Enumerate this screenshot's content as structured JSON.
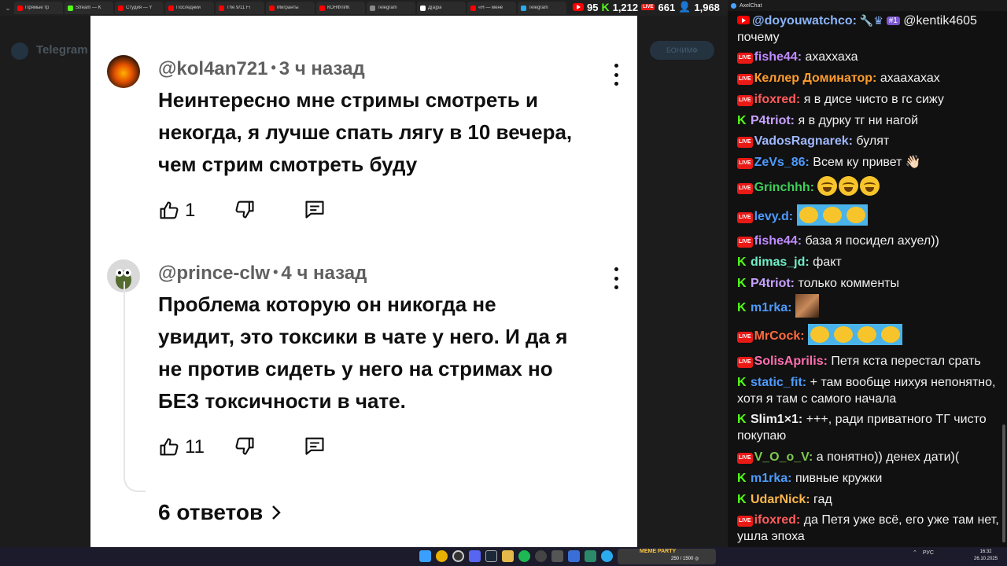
{
  "browser": {
    "tabs": [
      {
        "title": "Прямые тр",
        "color": "#ff0000"
      },
      {
        "title": "Stream — K",
        "color": "#53fc18"
      },
      {
        "title": "Студия — Y",
        "color": "#ff0000"
      },
      {
        "title": "Последний",
        "color": "#ff0000"
      },
      {
        "title": "The 9/11 Fi",
        "color": "#ff0000"
      },
      {
        "title": "Мигранты",
        "color": "#ff0000"
      },
      {
        "title": "КОНФЛИК",
        "color": "#ff0000"
      },
      {
        "title": "Telegram",
        "color": "#888888"
      },
      {
        "title": "Д[а]ра",
        "color": "#ffffff"
      },
      {
        "title": "«Я — мене",
        "color": "#ff0000"
      },
      {
        "title": "Telegram",
        "color": "#2aabee"
      }
    ]
  },
  "stats": {
    "youtube": "95",
    "kick": "1,212",
    "live": "661",
    "users": "1,968"
  },
  "background": {
    "app_title": "Telegram",
    "button": "БОНИМФ"
  },
  "comments": [
    {
      "author": "@kol4an721",
      "time": "3 ч назад",
      "text_lines": [
        "Неинтересно мне стримы смотреть и",
        "некогда, я лучше спать лягу в 10 вечера,",
        "чем стрим смотреть буду"
      ],
      "likes": "1"
    },
    {
      "author": "@prince-clw",
      "time": "4 ч назад",
      "text_lines": [
        "Проблема которую он никогда не",
        "увидит, это токсики в чате у него. И да я",
        "не против сидеть у него на стримах но",
        "БЕЗ токсичности в чате."
      ],
      "likes": "11",
      "replies": "6 ответов"
    }
  ],
  "chat": {
    "app": "AxelChat",
    "messages": [
      {
        "platform": "youtube",
        "nick": "@doyouwatchco:",
        "color": "#8ab4f8",
        "badge": "#1",
        "text": "@kentik4605 почему",
        "type": "badges"
      },
      {
        "platform": "live",
        "nick": "fishe44:",
        "color": "#c08bff",
        "text": "ахаххаха"
      },
      {
        "platform": "live",
        "nick": "Келлер Доминатор:",
        "color": "#ff9d2e",
        "text": "ахаахахах"
      },
      {
        "platform": "live",
        "nick": "ifoxred:",
        "color": "#ff5c5c",
        "text": "я в дисе чисто в гс сижу"
      },
      {
        "platform": "kick",
        "nick": "P4triot:",
        "color": "#c8a2ff",
        "text": "я в дурку тг ни нагой"
      },
      {
        "platform": "live",
        "nick": "VadosRagnarek:",
        "color": "#9fb8ff",
        "text": "булят"
      },
      {
        "platform": "live",
        "nick": "ZeVs_86:",
        "color": "#4d9bff",
        "text": "Всем ку привет 👋🏻"
      },
      {
        "platform": "live",
        "nick": "Grinchhh:",
        "color": "#3fcf5a",
        "text": "",
        "emotes": 3,
        "emote_type": "round"
      },
      {
        "platform": "live",
        "nick": "levy.d:",
        "color": "#4d9bff",
        "text": "",
        "emotes": 3,
        "emote_type": "wide"
      },
      {
        "platform": "live",
        "nick": "fishe44:",
        "color": "#c08bff",
        "text": "база я посидел ахуел))"
      },
      {
        "platform": "kick",
        "nick": "dimas_jd:",
        "color": "#6ff0c8",
        "text": "факт"
      },
      {
        "platform": "kick",
        "nick": "P4triot:",
        "color": "#c8a2ff",
        "text": "только комменты"
      },
      {
        "platform": "kick",
        "nick": "m1rka:",
        "color": "#4d9bff",
        "text": "",
        "emotes": 1,
        "emote_type": "photo"
      },
      {
        "platform": "live",
        "nick": "MrCock:",
        "color": "#ff6a3d",
        "text": "",
        "emotes": 4,
        "emote_type": "wide"
      },
      {
        "platform": "live",
        "nick": "SolisAprilis:",
        "color": "#ff6fb0",
        "text": "Петя кста перестал срать"
      },
      {
        "platform": "kick",
        "nick": "static_fit:",
        "color": "#4d9bff",
        "text": "+ там вообще нихуя непонятно, хотя я там с самого начала"
      },
      {
        "platform": "kick",
        "nick": "Slim1×1:",
        "color": "#f0f0f0",
        "text": "+++, ради приватного ТГ чисто покупаю"
      },
      {
        "platform": "live",
        "nick": "V_O_o_V:",
        "color": "#7ec850",
        "text": "а понятно)) денех дати)("
      },
      {
        "platform": "kick",
        "nick": "m1rka:",
        "color": "#4d9bff",
        "text": "пивные кружки"
      },
      {
        "platform": "kick",
        "nick": "UdarNick:",
        "color": "#ffb84d",
        "text": "гад"
      },
      {
        "platform": "live",
        "nick": "ifoxred:",
        "color": "#ff5c5c",
        "text": "да Петя уже всё, его уже там нет, ушла эпоха"
      }
    ]
  },
  "taskbar": {
    "widget_label": "MEME PARTY",
    "widget_value": "250 / 1500 ◎",
    "lang": "РУС",
    "time": "16:32",
    "date": "26.10.2025"
  }
}
